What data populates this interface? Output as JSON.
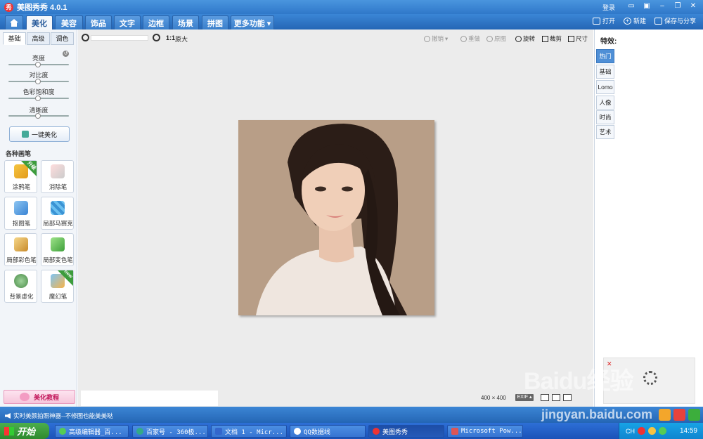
{
  "titlebar": {
    "title": "美图秀秀 4.0.1",
    "logo": "秀",
    "login": "登录"
  },
  "menu": {
    "tabs": [
      "美化",
      "美容",
      "饰品",
      "文字",
      "边框",
      "场景",
      "拼图",
      "更多功能 ▾"
    ],
    "active_tab": "美化",
    "actions": {
      "open": "打开",
      "new": "新建",
      "save": "保存与分享"
    }
  },
  "left": {
    "subtabs": [
      "基础",
      "高级",
      "调色"
    ],
    "sliders": [
      "亮度",
      "对比度",
      "色彩饱和度",
      "清晰度"
    ],
    "one_click": "一键美化",
    "brushes_title": "各种画笔",
    "brushes": [
      {
        "label": "涂鸦笔",
        "badge": "升级"
      },
      {
        "label": "消除笔",
        "badge": ""
      },
      {
        "label": "抠图笔",
        "badge": ""
      },
      {
        "label": "局部马赛克",
        "badge": ""
      },
      {
        "label": "局部彩色笔",
        "badge": ""
      },
      {
        "label": "局部变色笔",
        "badge": ""
      },
      {
        "label": "背景虚化",
        "badge": ""
      },
      {
        "label": "魔幻笔",
        "badge": "new"
      }
    ],
    "tutorial": "美化教程"
  },
  "toolbar": {
    "ratio": "1:1",
    "original": "原大",
    "undo": "撤销",
    "redo": "重做",
    "origin": "原图",
    "rotate": "旋转",
    "crop": "裁剪",
    "size": "尺寸"
  },
  "canvas": {
    "dims": "400 × 400",
    "exif": "EXIF ▴"
  },
  "right": {
    "effects_title": "特效:",
    "tabs": [
      "热门",
      "基础",
      "Lomo",
      "人像",
      "时尚",
      "艺术"
    ],
    "active_tab": "热门"
  },
  "status": {
    "text": "实时美颜拍照神器--不修图也能美美哒"
  },
  "taskbar": {
    "start": "开始",
    "tasks": [
      "高级编辑器_百...",
      "百家号 - 360极...",
      "文档 1 - Micr...",
      "QQ数据线",
      "美图秀秀",
      "Microsoft Pow..."
    ],
    "active_task": "美图秀秀",
    "lang": "CH",
    "clock": "14:59"
  },
  "watermark": {
    "brand": "Baidu经验",
    "site": "jingyan.baidu.com"
  },
  "colors": {
    "title_blue": "#2f78c9",
    "menu_blue": "#2466b5",
    "canvas_bg": "#ececec",
    "photo_bg": "#b99f88",
    "active_effect": "#4f8fd6"
  }
}
